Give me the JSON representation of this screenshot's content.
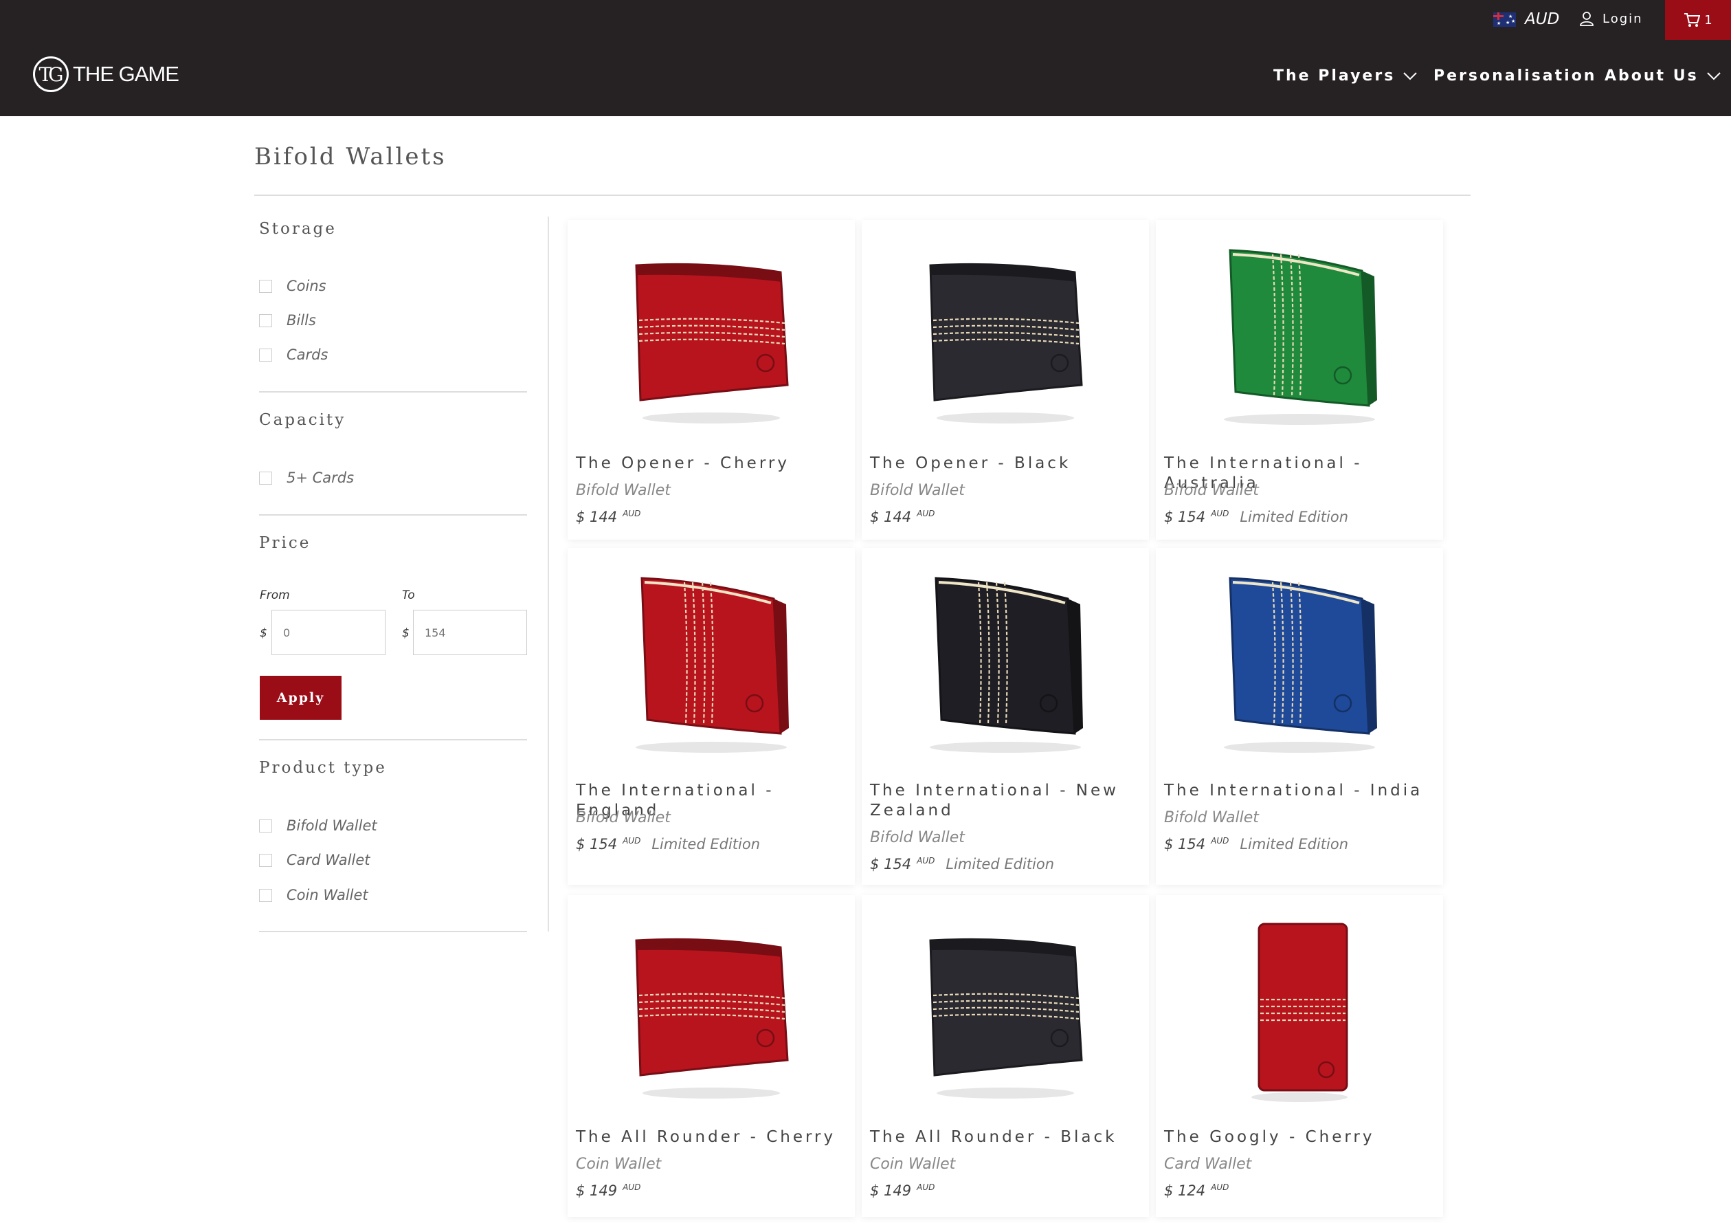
{
  "header": {
    "currency": "AUD",
    "login_label": "Login",
    "cart_count": "1",
    "logo_monogram": "TG",
    "logo_text": "THE GAME",
    "nav": [
      {
        "label": "The Players",
        "has_dropdown": true
      },
      {
        "label": "Personalisation",
        "has_dropdown": false
      },
      {
        "label": "About Us",
        "has_dropdown": true
      }
    ]
  },
  "page": {
    "title": "Bifold Wallets"
  },
  "filters": {
    "storage": {
      "heading": "Storage",
      "options": [
        "Coins",
        "Bills",
        "Cards"
      ]
    },
    "capacity": {
      "heading": "Capacity",
      "options": [
        "5+ Cards"
      ]
    },
    "price": {
      "heading": "Price",
      "from_label": "From",
      "to_label": "To",
      "currency_symbol": "$",
      "from_placeholder": "0",
      "to_placeholder": "154",
      "apply_label": "Apply"
    },
    "product_type": {
      "heading": "Product type",
      "options": [
        "Bifold Wallet",
        "Card Wallet",
        "Coin Wallet"
      ]
    }
  },
  "products": [
    {
      "name": "The Opener - Cherry",
      "type": "Bifold Wallet",
      "price": "$ 144",
      "currency": "AUD",
      "edition": "",
      "color": "#b8141e",
      "style": "opener"
    },
    {
      "name": "The Opener - Black",
      "type": "Bifold Wallet",
      "price": "$ 144",
      "currency": "AUD",
      "edition": "",
      "color": "#2a2a30",
      "style": "opener"
    },
    {
      "name": "The International - Australia",
      "type": "Bifold Wallet",
      "price": "$ 154",
      "currency": "AUD",
      "edition": "Limited Edition",
      "color": "#1f8a3c",
      "style": "international"
    },
    {
      "name": "The International - England",
      "type": "Bifold Wallet",
      "price": "$ 154",
      "currency": "AUD",
      "edition": "Limited Edition",
      "color": "#b8141e",
      "style": "international"
    },
    {
      "name": "The International - New Zealand",
      "type": "Bifold Wallet",
      "price": "$ 154",
      "currency": "AUD",
      "edition": "Limited Edition",
      "color": "#1e1e24",
      "style": "international"
    },
    {
      "name": "The International - India",
      "type": "Bifold Wallet",
      "price": "$ 154",
      "currency": "AUD",
      "edition": "Limited Edition",
      "color": "#1f4a9a",
      "style": "international"
    },
    {
      "name": "The All Rounder - Cherry",
      "type": "Coin Wallet",
      "price": "$ 149",
      "currency": "AUD",
      "edition": "",
      "color": "#b8141e",
      "style": "opener"
    },
    {
      "name": "The All Rounder - Black",
      "type": "Coin Wallet",
      "price": "$ 149",
      "currency": "AUD",
      "edition": "",
      "color": "#2a2a30",
      "style": "opener"
    },
    {
      "name": "The Googly - Cherry",
      "type": "Card Wallet",
      "price": "$ 124",
      "currency": "AUD",
      "edition": "",
      "color": "#b8141e",
      "style": "card"
    }
  ]
}
